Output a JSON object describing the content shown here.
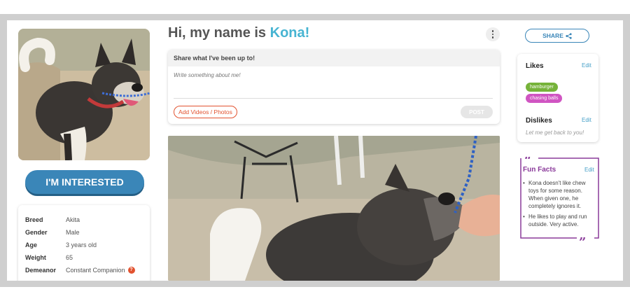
{
  "greeting": {
    "prefix": "Hi, my name is ",
    "name": "Kona!"
  },
  "interested_label": "I'M INTERESTED",
  "info": [
    {
      "key": "Breed",
      "value": "Akita"
    },
    {
      "key": "Gender",
      "value": "Male"
    },
    {
      "key": "Age",
      "value": "3 years old"
    },
    {
      "key": "Weight",
      "value": "65"
    },
    {
      "key": "Demeanor",
      "value": "Constant Companion"
    }
  ],
  "share_post": {
    "heading": "Share what I've been up to!",
    "placeholder": "Write something about me!",
    "add_media": "Add Videos / Photos",
    "post": "POST"
  },
  "share_button": "SHARE",
  "likes": {
    "title": "Likes",
    "edit": "Edit",
    "items": [
      "hamburger",
      "chasing balls"
    ]
  },
  "dislikes": {
    "title": "Dislikes",
    "edit": "Edit",
    "empty": "Let me get back to you!"
  },
  "fun_facts": {
    "title": "Fun Facts",
    "edit": "Edit",
    "items": [
      "Kona doesn't like chew toys for some reason. When given one, he completely ignores it.",
      "He likes to play and run outside. Very active."
    ]
  },
  "colors": {
    "accent_blue": "#3a86b8",
    "name_teal": "#47b4d2",
    "fun_facts_purple": "#8a3a9a",
    "orange": "#e2522f"
  }
}
